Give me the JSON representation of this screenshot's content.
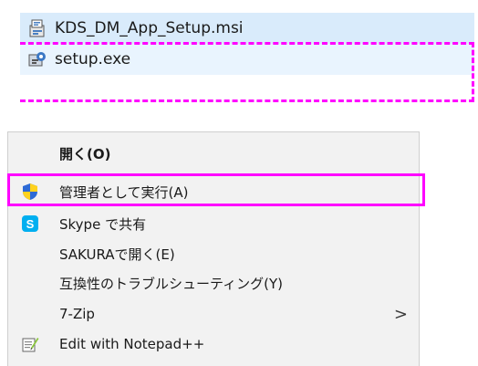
{
  "files": [
    {
      "name": "KDS_DM_App_Setup.msi",
      "icon": "msi-installer-icon"
    },
    {
      "name": "setup.exe",
      "icon": "setup-exe-icon"
    }
  ],
  "context_menu": {
    "items": [
      {
        "label": "開く(O)",
        "icon": null,
        "bold": true
      },
      {
        "label": "管理者として実行(A)",
        "icon": "shield-icon"
      },
      {
        "label": "Skype で共有",
        "icon": "skype-icon",
        "icon_text": "S"
      },
      {
        "label": "SAKURAで開く(E)",
        "icon": null
      },
      {
        "label": "互換性のトラブルシューティング(Y)",
        "icon": null
      },
      {
        "label": "7-Zip",
        "icon": null,
        "submenu_glyph": ">"
      },
      {
        "label": "Edit with Notepad++",
        "icon": "notepad-plus-plus-icon"
      }
    ]
  },
  "colors": {
    "highlight": "#ff00ff",
    "selected_row": "#d9ebfb",
    "hover_row": "#e9f4fe",
    "menu_bg": "#f2f2f2"
  }
}
